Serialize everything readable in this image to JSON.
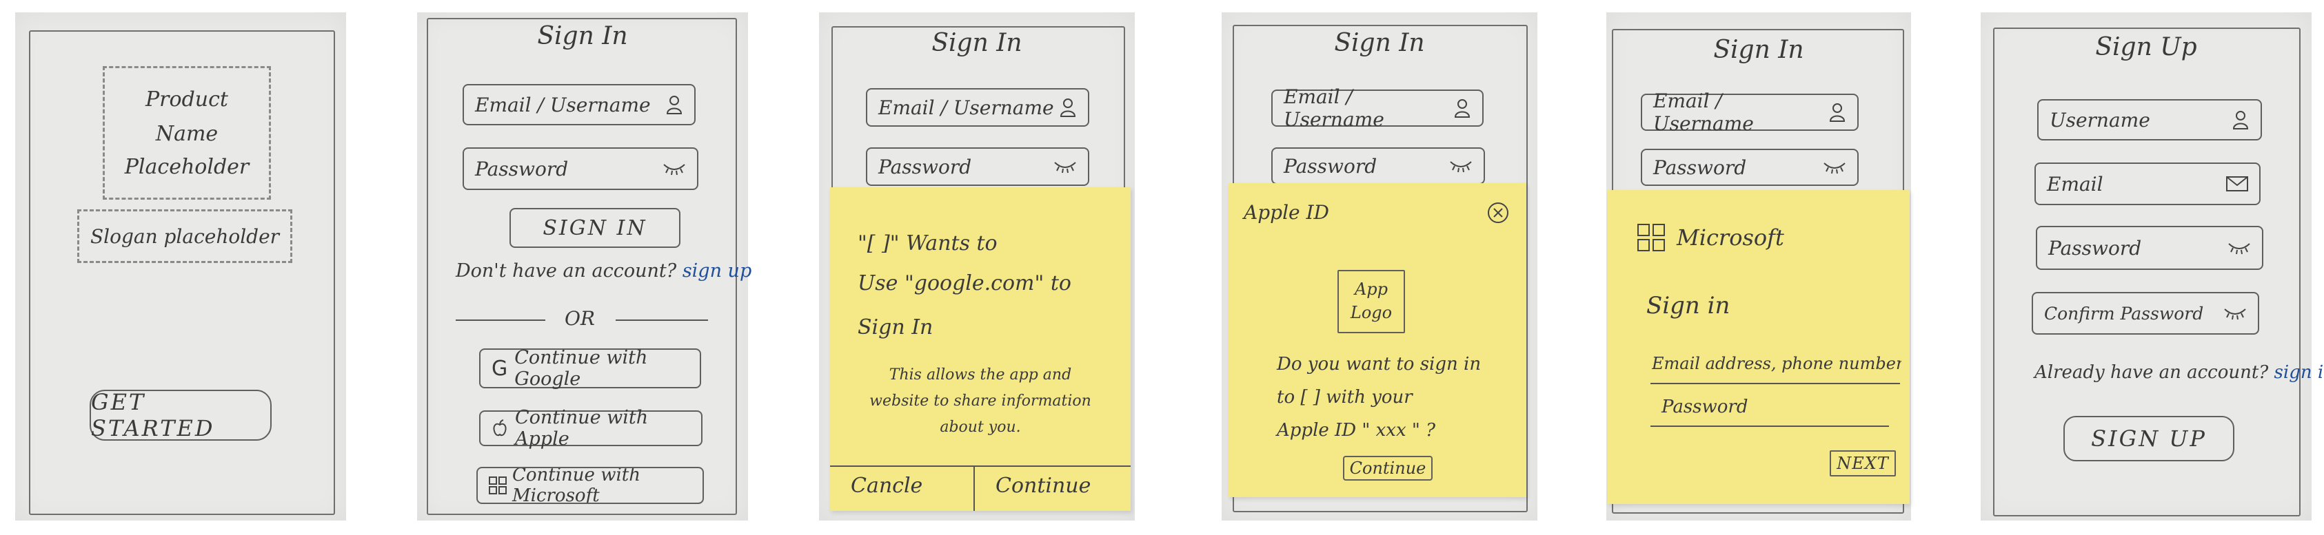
{
  "screens": {
    "welcome": {
      "product_name_line1": "Product",
      "product_name_line2": "Name",
      "product_name_line3": "Placeholder",
      "slogan": "Slogan placeholder",
      "get_started": "GET STARTED"
    },
    "sign_in": {
      "title": "Sign In",
      "email_placeholder": "Email / Username",
      "password_placeholder": "Password",
      "sign_in_button": "SIGN IN",
      "no_account_text": "Don't have an account?",
      "sign_up_link": "sign up",
      "or_divider": "OR",
      "google_button": "Continue with Google",
      "apple_button": "Continue with Apple",
      "microsoft_button": "Continue with Microsoft"
    },
    "google_prompt": {
      "title": "Sign In",
      "email_placeholder": "Email / Username",
      "password_placeholder": "Password",
      "line1": "\"[      ]\" Wants to",
      "line2": "Use \"google.com\" to",
      "line3": "Sign In",
      "info_line1": "This allows the app and",
      "info_line2": "website to share information",
      "info_line3": "about you.",
      "cancel": "Cancle",
      "continue": "Continue"
    },
    "apple_prompt": {
      "title": "Sign In",
      "email_placeholder": "Email / Username",
      "password_placeholder": "Password",
      "header": "Apple ID",
      "app_logo_line1": "App",
      "app_logo_line2": "Logo",
      "question_line1": "Do you want to sign in",
      "question_line2": "to [      ] with your",
      "question_line3": "Apple ID \" xxx \" ?",
      "continue": "Continue"
    },
    "microsoft_prompt": {
      "title": "Sign In",
      "email_placeholder": "Email / Username",
      "password_placeholder": "Password",
      "brand": "Microsoft",
      "heading": "Sign in",
      "email_field": "Email address, phone number",
      "password_field": "Password",
      "next": "NEXT"
    },
    "sign_up": {
      "title": "Sign Up",
      "username_placeholder": "Username",
      "email_placeholder": "Email",
      "password_placeholder": "Password",
      "confirm_placeholder": "Confirm Password",
      "have_account_text": "Already have an account?",
      "sign_in_link": "sign in",
      "sign_up_button": "SIGN UP"
    }
  },
  "colors": {
    "paper": "#e9e9e7",
    "sticky_note": "#f5e886",
    "ink": "#3a3a3a",
    "link_ink": "#1f4e9a"
  }
}
